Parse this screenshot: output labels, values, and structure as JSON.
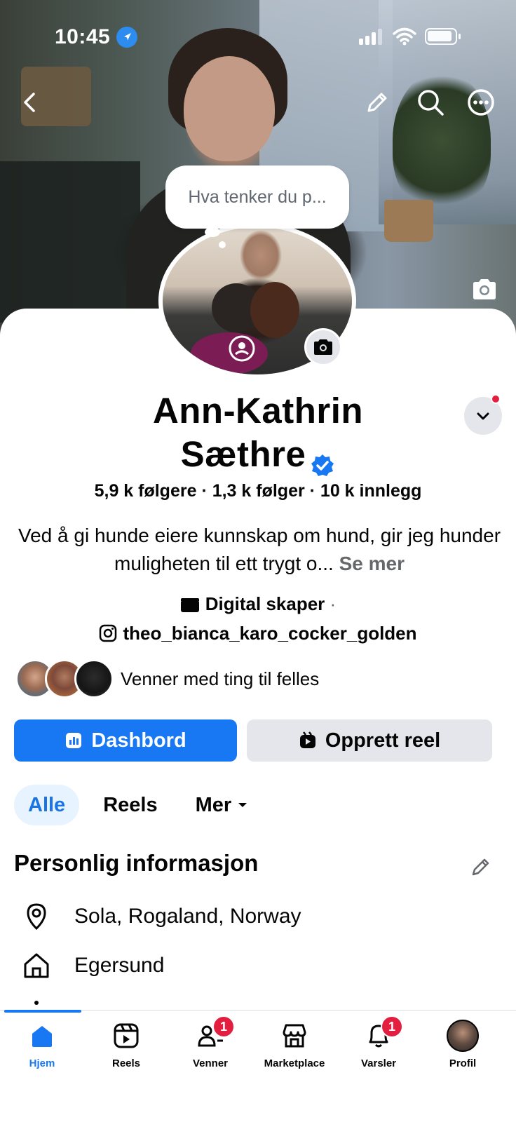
{
  "status_bar": {
    "time": "10:45"
  },
  "composer": {
    "placeholder": "Hva tenker du p..."
  },
  "profile": {
    "name_line1": "Ann-Kathrin",
    "name_line2": "Sæthre",
    "stats": "5,9 k følgere · 1,3 k følger · 10 k innlegg",
    "bio": "Ved å gi hunde eiere kunnskap om hund, gir jeg hunder muligheten til ett trygt o...",
    "see_more": "Se mer",
    "category": "Digital skaper",
    "category_sep": "·",
    "instagram": "theo_bianca_karo_cocker_golden",
    "mutual_friends": "Venner med ting til felles"
  },
  "buttons": {
    "dashboard": "Dashbord",
    "create_reel": "Opprett reel"
  },
  "tabs": [
    {
      "label": "Alle",
      "active": true
    },
    {
      "label": "Reels",
      "active": false
    },
    {
      "label": "Mer",
      "active": false
    }
  ],
  "personal_info": {
    "title": "Personlig informasjon",
    "location": "Sola, Rogaland, Norway",
    "hometown": "Egersund"
  },
  "bottom_nav": [
    {
      "label": "Hjem",
      "icon": "home-icon",
      "active": true
    },
    {
      "label": "Reels",
      "icon": "reels-icon"
    },
    {
      "label": "Venner",
      "icon": "friends-icon",
      "badge": "1"
    },
    {
      "label": "Marketplace",
      "icon": "marketplace-icon"
    },
    {
      "label": "Varsler",
      "icon": "bell-icon",
      "badge": "1"
    },
    {
      "label": "Profil",
      "icon": "profile-avatar"
    }
  ],
  "colors": {
    "accent": "#1877f2",
    "badge": "#e41e3f",
    "secondary_button": "#e4e6eb"
  }
}
